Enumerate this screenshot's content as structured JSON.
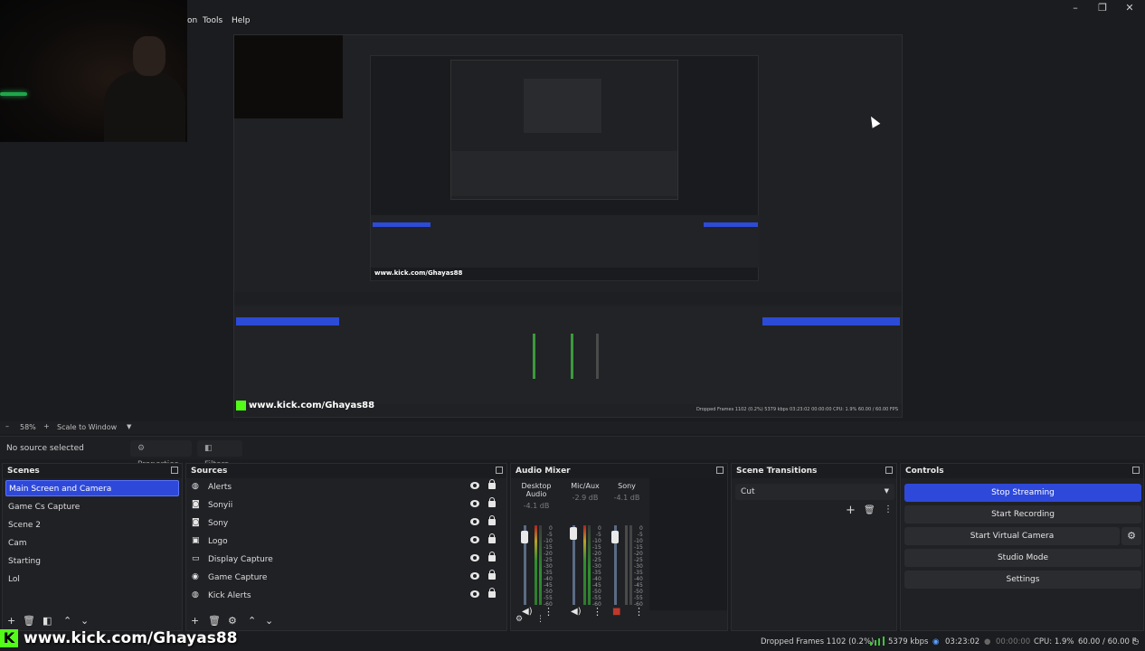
{
  "menu": {
    "items": [
      "on",
      "Tools",
      "Help"
    ]
  },
  "window_controls": {
    "minimize": "–",
    "restore": "❐",
    "close": "✕"
  },
  "preview": {
    "nested_kick_url": "www.kick.com/Ghayas88",
    "nested_status": "Dropped Frames 1102 (0.2%)   5379 kbps   03:23:02   00:00:00   CPU: 1.9%  60.00 / 60.00 FPS"
  },
  "zoom": {
    "minus": "–",
    "value": "58%",
    "plus": "+",
    "scale_mode": "Scale to Window"
  },
  "source_bar": {
    "no_source": "No source selected",
    "properties": "Properties",
    "filters": "Filters"
  },
  "scenes": {
    "title": "Scenes",
    "items": [
      "Main Screen and Camera",
      "Game Cs Capture",
      "Scene 2",
      "Cam",
      "Starting",
      "Lol"
    ],
    "selected": "Main Screen and Camera"
  },
  "sources": {
    "title": "Sources",
    "items": [
      {
        "label": "Alerts",
        "icon": "browser-icon"
      },
      {
        "label": "Sonyii",
        "icon": "camera-icon"
      },
      {
        "label": "Sony",
        "icon": "camera-icon"
      },
      {
        "label": "Logo",
        "icon": "image-icon"
      },
      {
        "label": "Display Capture",
        "icon": "monitor-icon"
      },
      {
        "label": "Game Capture",
        "icon": "gamepad-icon"
      },
      {
        "label": "Kick Alerts",
        "icon": "browser-icon"
      }
    ]
  },
  "audio_mixer": {
    "title": "Audio Mixer",
    "channels": [
      {
        "name": "Desktop Audio",
        "db": "-4.1 dB"
      },
      {
        "name": "Mic/Aux",
        "db": "-2.9 dB"
      },
      {
        "name": "Sony",
        "db": "-4.1 dB"
      }
    ],
    "scale": [
      "0",
      "-5",
      "-10",
      "-15",
      "-20",
      "-25",
      "-30",
      "-35",
      "-40",
      "-45",
      "-50",
      "-55",
      "-60"
    ]
  },
  "scene_transitions": {
    "title": "Scene Transitions",
    "selected": "Cut"
  },
  "controls": {
    "title": "Controls",
    "stop_streaming": "Stop Streaming",
    "start_recording": "Start Recording",
    "start_virtual_camera": "Start Virtual Camera",
    "studio_mode": "Studio Mode",
    "settings": "Settings"
  },
  "status": {
    "dropped_frames": "Dropped Frames 1102 (0.2%)",
    "kbps": "5379 kbps",
    "stream_time": "03:23:02",
    "record_time": "00:00:00",
    "cpu": "CPU: 1.9%",
    "fps": "60.00 / 60.00 F"
  },
  "overlay": {
    "kick_logo": "K",
    "kick_url": "www.kick.com/Ghayas88"
  },
  "colors": {
    "accent": "#2e49d9",
    "kick_green": "#53fc18",
    "bg": "#1b1c1f"
  }
}
